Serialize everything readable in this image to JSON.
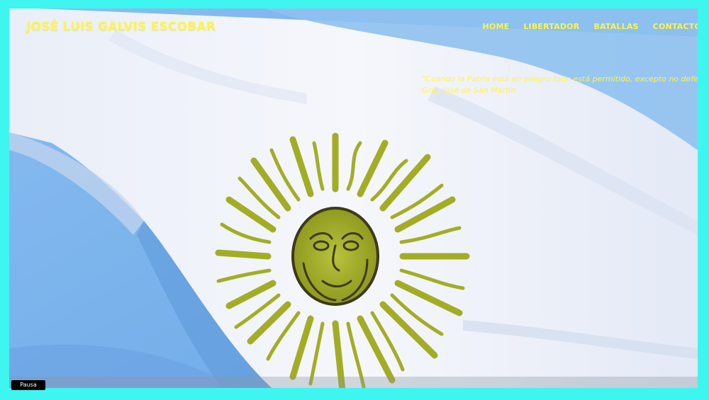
{
  "header": {
    "title": "JOSÉ LUIS GALVIS ESCOBAR"
  },
  "nav": {
    "items": [
      {
        "label": "HOME"
      },
      {
        "label": "LIBERTADOR"
      },
      {
        "label": "BATALLAS"
      },
      {
        "label": "CONTACTO"
      }
    ]
  },
  "hero": {
    "quote": "\"Cuando la Patria está en peligro todo está permitido, excepto no defenderla\".",
    "author": "Gral. José de San Martín"
  },
  "video": {
    "pause_label": "Pausa"
  },
  "colors": {
    "frame": "#3ff5ef",
    "accent_text": "#fff44a",
    "flag_blue": "#7fb6ea",
    "flag_white": "#f3f5fb",
    "sun": "#a9b52a"
  }
}
